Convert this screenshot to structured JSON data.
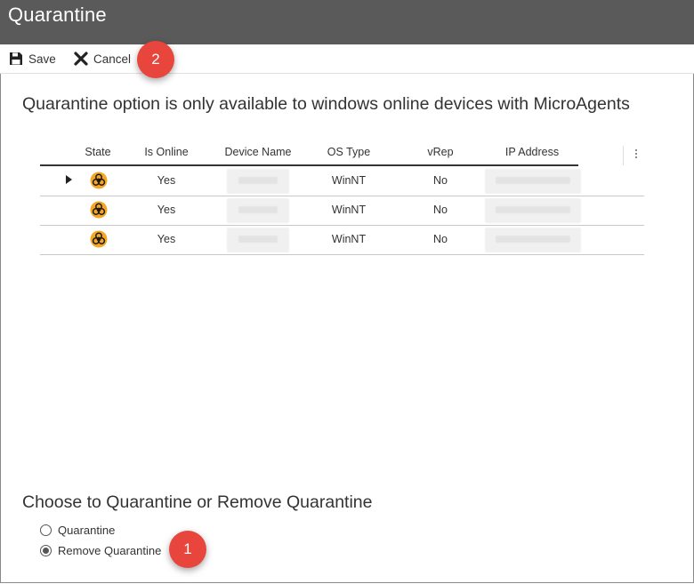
{
  "dialog": {
    "title": "Quarantine"
  },
  "toolbar": {
    "save_label": "Save",
    "cancel_label": "Cancel"
  },
  "callouts": {
    "first": "1",
    "second": "2"
  },
  "notice": "Quarantine option is only available to windows online devices with MicroAgents",
  "grid": {
    "columns": [
      "State",
      "Is Online",
      "Device Name",
      "OS Type",
      "vRep",
      "IP Address"
    ],
    "rows": [
      {
        "state_icon": "biohazard-icon",
        "expanded_arrow": true,
        "is_online": "Yes",
        "os_type": "WinNT",
        "vrep": "No"
      },
      {
        "state_icon": "biohazard-icon",
        "expanded_arrow": false,
        "is_online": "Yes",
        "os_type": "WinNT",
        "vrep": "No"
      },
      {
        "state_icon": "biohazard-icon",
        "expanded_arrow": false,
        "is_online": "Yes",
        "os_type": "WinNT",
        "vrep": "No"
      }
    ]
  },
  "quarantine_choice": {
    "heading": "Choose to Quarantine or Remove Quarantine",
    "options": [
      {
        "label": "Quarantine",
        "selected": false
      },
      {
        "label": "Remove Quarantine",
        "selected": true
      }
    ]
  },
  "colors": {
    "title_bar": "#5a5a5a",
    "callout": "#e8453c",
    "biohazard": "#f5a623"
  }
}
